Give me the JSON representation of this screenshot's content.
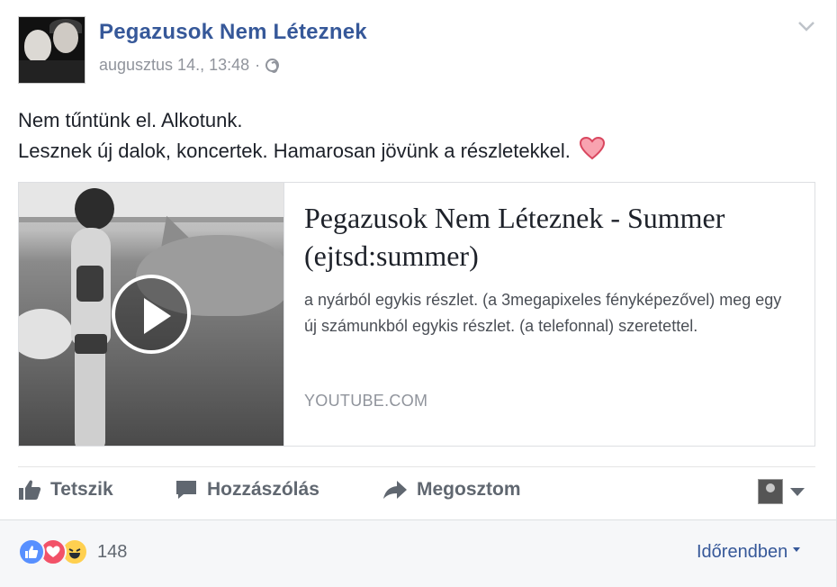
{
  "post": {
    "author": "Pegazusok Nem Léteznek",
    "timestamp": "augusztus 14., 13:48",
    "separator": "·",
    "privacy_icon": "globe-icon",
    "menu_icon": "chevron-down-icon",
    "text_line1": "Nem tűntünk el. Alkotunk.",
    "text_line2": "Lesznek új dalok, koncertek. Hamarosan jövünk a részletekkel.",
    "text_emoji": "heart-icon"
  },
  "link_preview": {
    "title": "Pegazusok Nem Léteznek - Summer (ejtsd:summer)",
    "description": "a nyárból egykis részlet. (a 3megapixeles fényképezővel) meg egy új számunkból egykis részlet. (a telefonnal) szeretettel.",
    "domain": "YOUTUBE.COM",
    "play_icon": "play-icon"
  },
  "actions": {
    "like": "Tetszik",
    "comment": "Hozzászólás",
    "share": "Megosztom",
    "like_icon": "thumbs-up-icon",
    "comment_icon": "speech-bubble-icon",
    "share_icon": "share-arrow-icon"
  },
  "footer": {
    "reaction_count": "148",
    "reactions": [
      "like-reaction-icon",
      "love-reaction-icon",
      "haha-reaction-icon"
    ],
    "order_label": "Időrendben"
  },
  "colors": {
    "link_blue": "#365899",
    "meta_gray": "#90949c",
    "action_gray": "#606770",
    "like_blue": "#5890ff",
    "love_red": "#f25268",
    "haha_yellow": "#ffd050"
  }
}
